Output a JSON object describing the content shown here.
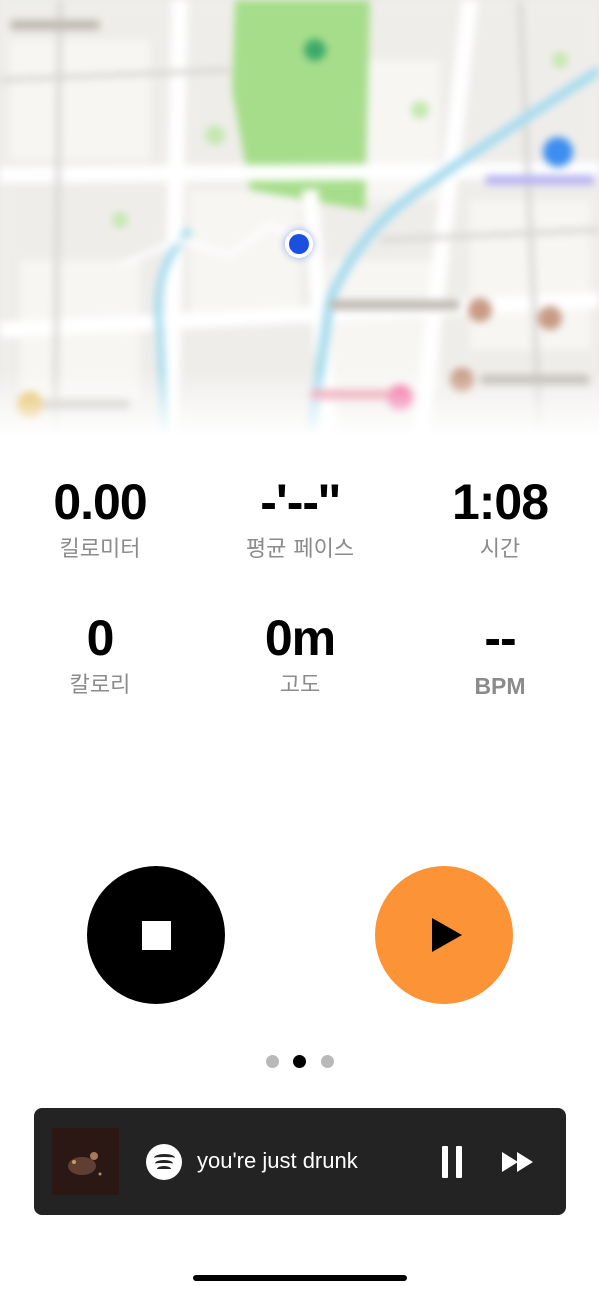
{
  "map": {
    "accent_park": "#a6dd8a",
    "accent_water": "#a9dcee",
    "location_dot_color": "#1a4fe0"
  },
  "stats": {
    "distance": {
      "value": "0.00",
      "label": "킬로미터"
    },
    "pace": {
      "value": "-'--''",
      "label": "평균 페이스"
    },
    "time": {
      "value": "1:08",
      "label": "시간"
    },
    "calories": {
      "value": "0",
      "label": "칼로리"
    },
    "altitude": {
      "value": "0m",
      "label": "고도"
    },
    "heart_rate": {
      "value": "--",
      "label": "BPM"
    }
  },
  "controls": {
    "stop_icon": "stop-square-icon",
    "play_icon": "play-triangle-icon",
    "play_color": "#fd9337",
    "stop_color": "#000000"
  },
  "pager": {
    "count": 3,
    "active_index": 1
  },
  "music": {
    "service_icon": "spotify-icon",
    "track_title": "you're just drunk",
    "pause_icon": "pause-icon",
    "next_icon": "fast-forward-icon",
    "bar_color": "#232323"
  }
}
